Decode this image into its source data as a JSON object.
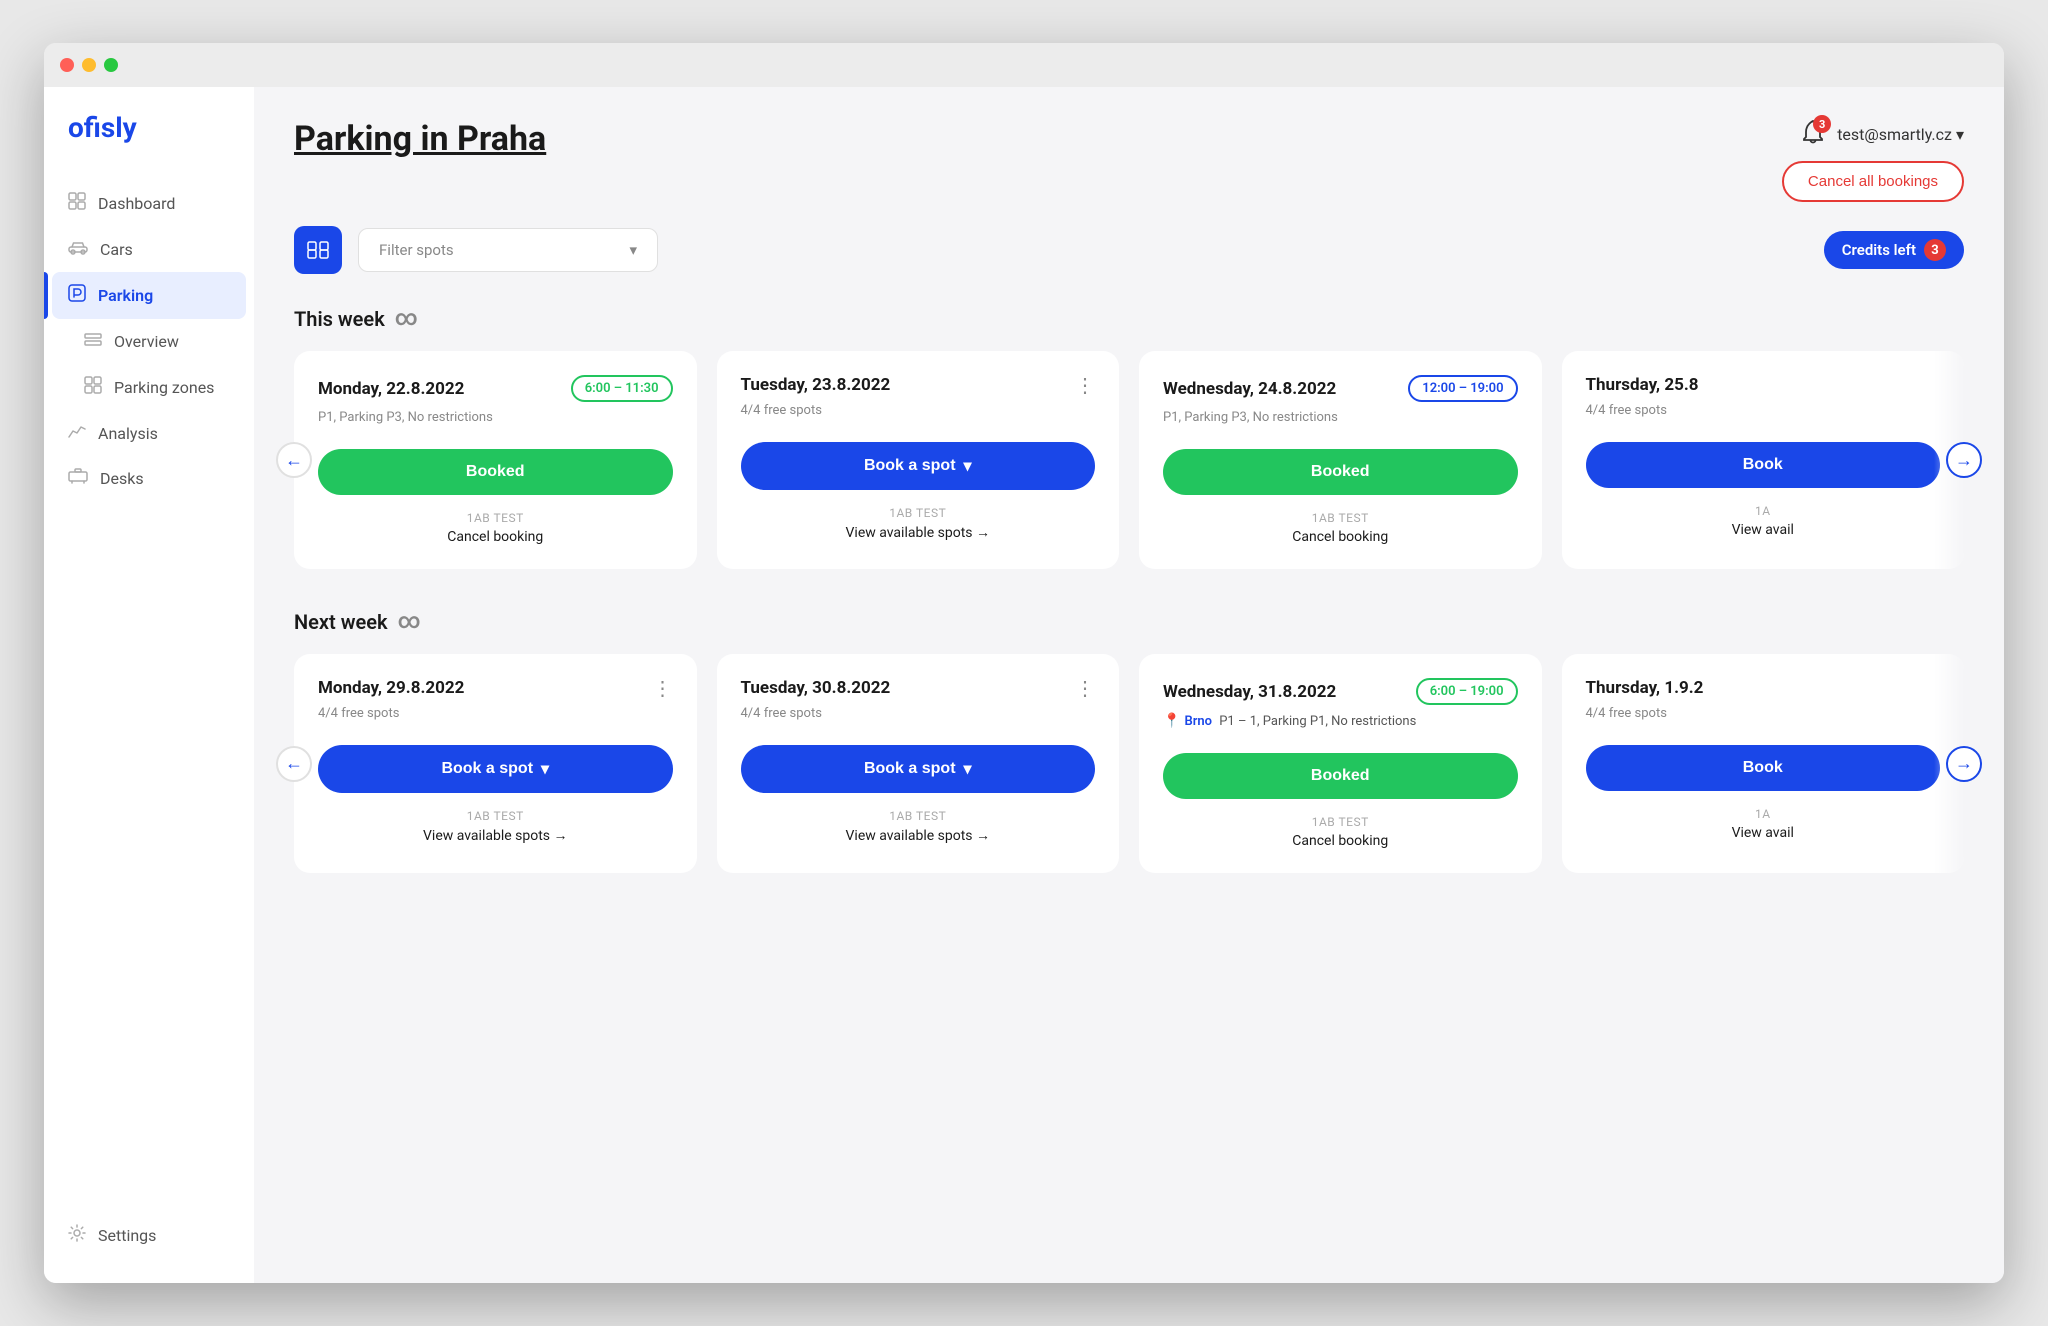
{
  "app": {
    "logo": "ofisly"
  },
  "titlebar": {
    "traffic": [
      "red",
      "yellow",
      "green"
    ]
  },
  "sidebar": {
    "items": [
      {
        "label": "Dashboard",
        "icon": "⊞",
        "active": false,
        "name": "dashboard"
      },
      {
        "label": "Cars",
        "icon": "🚗",
        "active": false,
        "name": "cars"
      },
      {
        "label": "Parking",
        "icon": "P",
        "active": true,
        "name": "parking"
      },
      {
        "label": "Overview",
        "icon": "⊟",
        "active": false,
        "name": "overview"
      },
      {
        "label": "Parking zones",
        "icon": "⊞",
        "active": false,
        "name": "parking-zones"
      },
      {
        "label": "Analysis",
        "icon": "📈",
        "active": false,
        "name": "analysis"
      },
      {
        "label": "Desks",
        "icon": "🖥",
        "active": false,
        "name": "desks"
      }
    ],
    "bottom_item": {
      "label": "Settings",
      "icon": "⚙"
    }
  },
  "header": {
    "title_prefix": "Parking in ",
    "title_city": "Praha",
    "user": "test@smartly.cz",
    "bell_count": "3",
    "cancel_all_label": "Cancel all bookings",
    "credits_label": "Credits left",
    "credits_count": "3"
  },
  "filter": {
    "icon": "≡",
    "placeholder": "Filter spots",
    "chevron": "▾"
  },
  "this_week": {
    "label": "This week",
    "cards": [
      {
        "date": "Monday, 22.8.2022",
        "time_badge": "6:00 – 11:30",
        "time_badge_color": "green",
        "sub": "P1, Parking P3, No restrictions",
        "btn_type": "booked",
        "btn_label": "Booked",
        "car_label": "1AB TEST",
        "action": "Cancel booking",
        "action_arrow": false,
        "three_dots": false,
        "location": null
      },
      {
        "date": "Tuesday, 23.8.2022",
        "time_badge": null,
        "sub": "4/4 free spots",
        "btn_type": "book",
        "btn_label": "Book a spot",
        "car_label": "1AB TEST",
        "action": "View available spots →",
        "action_arrow": true,
        "three_dots": true,
        "location": null
      },
      {
        "date": "Wednesday, 24.8.2022",
        "time_badge": "12:00 – 19:00",
        "time_badge_color": "blue",
        "sub": "P1, Parking P3, No restrictions",
        "btn_type": "booked",
        "btn_label": "Booked",
        "car_label": "1AB TEST",
        "action": "Cancel booking",
        "action_arrow": false,
        "three_dots": false,
        "location": null
      },
      {
        "date": "Thursday, 25.8",
        "time_badge": null,
        "sub": "4/4 free spots",
        "btn_type": "book",
        "btn_label": "Book",
        "car_label": "1A",
        "action": "View avail",
        "action_arrow": true,
        "three_dots": false,
        "location": null,
        "clipped": true
      }
    ]
  },
  "next_week": {
    "label": "Next week",
    "cards": [
      {
        "date": "Monday, 29.8.2022",
        "time_badge": null,
        "sub": "4/4 free spots",
        "btn_type": "book",
        "btn_label": "Book a spot",
        "car_label": "1AB TEST",
        "action": "View available spots →",
        "action_arrow": true,
        "three_dots": true,
        "location": null
      },
      {
        "date": "Tuesday, 30.8.2022",
        "time_badge": null,
        "sub": "4/4 free spots",
        "btn_type": "book",
        "btn_label": "Book a spot",
        "car_label": "1AB TEST",
        "action": "View available spots →",
        "action_arrow": true,
        "three_dots": true,
        "location": null
      },
      {
        "date": "Wednesday, 31.8.2022",
        "time_badge": "6:00 – 19:00",
        "time_badge_color": "green",
        "sub": "P1 – 1, Parking P1, No restrictions",
        "btn_type": "booked",
        "btn_label": "Booked",
        "car_label": "1AB TEST",
        "action": "Cancel booking",
        "action_arrow": false,
        "three_dots": false,
        "location": "Brno"
      },
      {
        "date": "Thursday, 1.9.2",
        "time_badge": null,
        "sub": "4/4 free spots",
        "btn_type": "book",
        "btn_label": "Book",
        "car_label": "1A",
        "action": "View avail",
        "action_arrow": true,
        "three_dots": false,
        "location": null,
        "clipped": true
      }
    ]
  }
}
